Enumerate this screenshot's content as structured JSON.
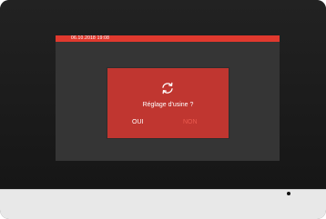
{
  "status_bar": {
    "datetime": "06.10.2018   19:08"
  },
  "dialog": {
    "icon": "refresh-icon",
    "title": "Réglage d'usine ?",
    "yes_label": "OUI",
    "no_label": "NON"
  },
  "colors": {
    "accent": "#e0392e",
    "dialog_bg": "#c03630",
    "screen_bg": "#353535",
    "no_button": "#ea5a4e"
  }
}
